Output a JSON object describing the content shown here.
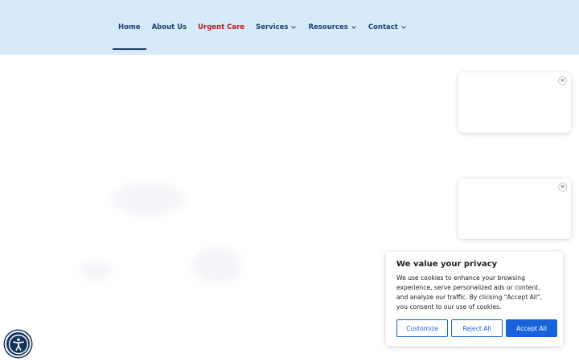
{
  "nav": {
    "home": "Home",
    "about": "About Us",
    "urgent": "Urgent Care",
    "services": "Services",
    "resources": "Resources",
    "contact": "Contact"
  },
  "popups": {
    "close_symbol": "×"
  },
  "cookie": {
    "title": "We value your privacy",
    "text": "We use cookies to enhance your browsing experience, serve personalized ads or content, and analyze our traffic. By clicking \"Accept All\", you consent to our use of cookies.",
    "customize": "Customize",
    "reject": "Reject All",
    "accept": "Accept All"
  },
  "colors": {
    "header_bg": "#d6eaf9",
    "nav_text": "#1f3f6e",
    "urgent": "#c0141e",
    "cookie_accent": "#1863dc",
    "a11y_bg": "#14335a"
  },
  "icons": {
    "dropdown": "chevron-down-icon",
    "close": "close-icon",
    "accessibility": "accessibility-icon"
  }
}
